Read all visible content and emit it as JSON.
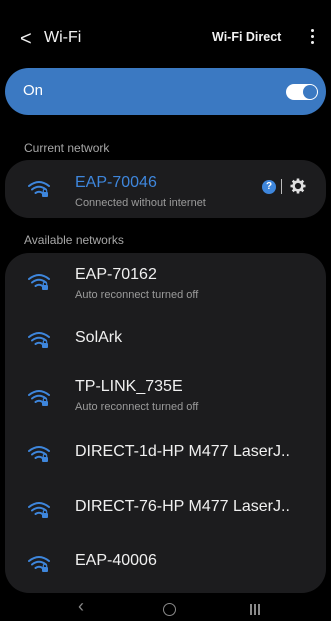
{
  "header": {
    "back_symbol": "<",
    "title": "Wi-Fi",
    "wifi_direct_label": "Wi-Fi Direct"
  },
  "toggle": {
    "label": "On",
    "state": "on",
    "accent_color": "#3b79c2"
  },
  "current_section_label": "Current network",
  "current_network": {
    "name": "EAP-70046",
    "status": "Connected without internet",
    "help_symbol": "?",
    "name_color": "#3e86dc"
  },
  "available_section_label": "Available networks",
  "networks": [
    {
      "name": "EAP-70162",
      "sub": "Auto reconnect turned off"
    },
    {
      "name": "SolArk",
      "sub": ""
    },
    {
      "name": "TP-LINK_735E",
      "sub": "Auto reconnect turned off"
    },
    {
      "name": "DIRECT-1d-HP M477 LaserJ..",
      "sub": ""
    },
    {
      "name": "DIRECT-76-HP M477 LaserJ..",
      "sub": ""
    },
    {
      "name": "EAP-40006",
      "sub": ""
    }
  ],
  "icons": {
    "wifi": "wifi-lock-icon",
    "more": "more-vertical-icon",
    "settings": "gear-icon",
    "help": "help-icon"
  }
}
